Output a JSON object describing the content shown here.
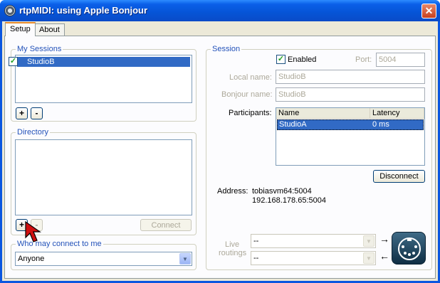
{
  "window": {
    "title": "rtpMIDI: using Apple Bonjour",
    "close_glyph": "✕"
  },
  "tabs": [
    {
      "label": "Setup",
      "selected": true
    },
    {
      "label": "About",
      "selected": false
    }
  ],
  "my_sessions": {
    "title": "My Sessions",
    "items": [
      {
        "label": "StudioB",
        "checked": true,
        "selected": true
      }
    ],
    "add_label": "+",
    "remove_label": "-"
  },
  "directory": {
    "title": "Directory",
    "add_label": "+",
    "remove_label": "-",
    "connect_label": "Connect"
  },
  "who_may_connect": {
    "title": "Who may connect to me",
    "value": "Anyone"
  },
  "session": {
    "title": "Session",
    "enabled_label": "Enabled",
    "enabled_checked": true,
    "port_label": "Port:",
    "port_value": "5004",
    "local_name_label": "Local name:",
    "local_name_value": "StudioB",
    "bonjour_name_label": "Bonjour name:",
    "bonjour_name_value": "StudioB",
    "participants_label": "Participants:",
    "participants_columns": [
      "Name",
      "Latency"
    ],
    "participants_rows": [
      {
        "name": "StudioA",
        "latency": "0 ms"
      }
    ],
    "disconnect_label": "Disconnect",
    "address_label": "Address:",
    "address_line1": "tobiasvm64:5004",
    "address_line2": "192.168.178.65:5004",
    "live_routings_label_1": "Live",
    "live_routings_label_2": "routings",
    "routing_in_value": "--",
    "routing_out_value": "--",
    "arrow_right": "→",
    "arrow_left": "←"
  },
  "colors": {
    "title_bar": "#0a56e0",
    "selection": "#316ac5",
    "group_title": "#2352b9",
    "cursor_red": "#d01010"
  },
  "icons": [
    "app-icon",
    "close-icon",
    "midi-port-icon",
    "mouse-cursor-icon"
  ]
}
